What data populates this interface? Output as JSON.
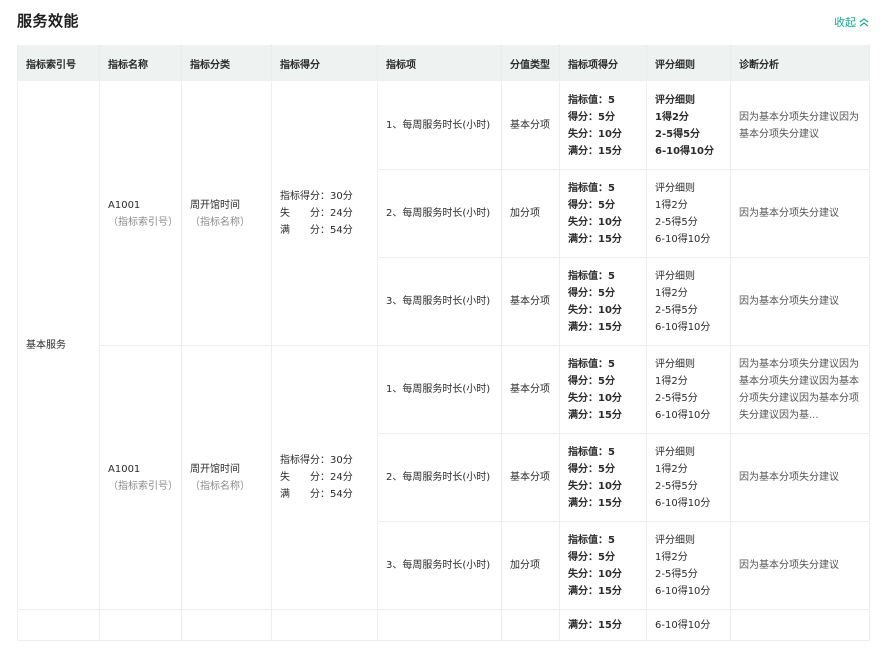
{
  "page": {
    "title": "服务效能",
    "collapse_label": "收起"
  },
  "table": {
    "headers": [
      "指标索引号",
      "指标名称",
      "指标分类",
      "指标得分",
      "指标项",
      "分值类型",
      "指标项得分",
      "评分细则",
      "诊断分析"
    ],
    "category": "基本服务",
    "groups": [
      {
        "index_id": "A1001",
        "index_id_sub": "（指标索引号）",
        "name": "周开馆时间",
        "name_sub": "（指标名称）",
        "score_lines": [
          "指标得分：30分",
          "失　　分：24分",
          "满　　分：54分"
        ],
        "items": [
          {
            "item": "1、每周服务时长(小时)",
            "type": "基本分项",
            "scores": [
              "指标值：5",
              "得分：5分",
              "失分：10分",
              "满分：15分"
            ],
            "rules": [
              "评分细则",
              "1得2分",
              "2-5得5分",
              "6-10得10分"
            ],
            "diagnosis": "因为基本分项失分建议因为基本分项失分建议"
          },
          {
            "item": "2、每周服务时长(小时)",
            "type": "加分项",
            "scores": [
              "指标值：5",
              "得分：5分",
              "失分：10分",
              "满分：15分"
            ],
            "rules": [
              "评分细则",
              "1得2分",
              "2-5得5分",
              "6-10得10分"
            ],
            "diagnosis": "因为基本分项失分建议"
          },
          {
            "item": "3、每周服务时长(小时)",
            "type": "基本分项",
            "scores": [
              "指标值：5",
              "得分：5分",
              "失分：10分",
              "满分：15分"
            ],
            "rules": [
              "评分细则",
              "1得2分",
              "2-5得5分",
              "6-10得10分"
            ],
            "diagnosis": "因为基本分项失分建议"
          }
        ]
      },
      {
        "index_id": "A1001",
        "index_id_sub": "（指标索引号）",
        "name": "周开馆时间",
        "name_sub": "（指标名称）",
        "score_lines": [
          "指标得分：30分",
          "失　　分：24分",
          "满　　分：54分"
        ],
        "items": [
          {
            "item": "1、每周服务时长(小时)",
            "type": "基本分项",
            "scores": [
              "指标值：5",
              "得分：5分",
              "失分：10分",
              "满分：15分"
            ],
            "rules": [
              "评分细则",
              "1得2分",
              "2-5得5分",
              "6-10得10分"
            ],
            "diagnosis": "因为基本分项失分建议因为基本分项失分建议因为基本分项失分建议因为基本分项失分建议因为基..."
          },
          {
            "item": "2、每周服务时长(小时)",
            "type": "基本分项",
            "scores": [
              "指标值：5",
              "得分：5分",
              "失分：10分",
              "满分：15分"
            ],
            "rules": [
              "评分细则",
              "1得2分",
              "2-5得5分",
              "6-10得10分"
            ],
            "diagnosis": "因为基本分项失分建议"
          },
          {
            "item": "3、每周服务时长(小时)",
            "type": "加分项",
            "scores": [
              "指标值：5",
              "得分：5分",
              "失分：10分",
              "满分：15分"
            ],
            "rules": [
              "评分细则",
              "1得2分",
              "2-5得5分",
              "6-10得10分"
            ],
            "diagnosis": "因为基本分项失分建议"
          }
        ]
      }
    ],
    "partial_row": {
      "score": "满分：15分",
      "rule": "6-10得10分"
    }
  }
}
